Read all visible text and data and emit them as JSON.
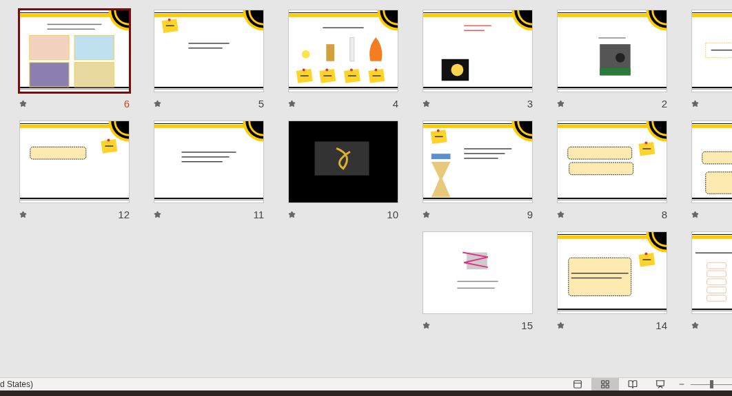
{
  "rows": [
    [
      {
        "number": "6",
        "selected": true,
        "kind": "gallery"
      },
      {
        "number": "5",
        "selected": false,
        "kind": "note"
      },
      {
        "number": "4",
        "selected": false,
        "kind": "objects"
      },
      {
        "number": "3",
        "selected": false,
        "kind": "bulb"
      },
      {
        "number": "2",
        "selected": false,
        "kind": "photo"
      },
      {
        "selected": false,
        "kind": "framed"
      }
    ],
    [
      {
        "number": "12",
        "selected": false,
        "kind": "notebox"
      },
      {
        "number": "11",
        "selected": false,
        "kind": "text"
      },
      {
        "number": "10",
        "selected": false,
        "kind": "calligraphy"
      },
      {
        "number": "9",
        "selected": false,
        "kind": "hourglass"
      },
      {
        "number": "8",
        "selected": false,
        "kind": "boxes"
      },
      {
        "selected": false,
        "kind": "widebox"
      }
    ],
    [
      {
        "number": "15",
        "selected": false,
        "kind": "logo"
      },
      {
        "number": "14",
        "selected": false,
        "kind": "bigbox"
      },
      {
        "selected": false,
        "kind": "table"
      }
    ]
  ],
  "status_bar": {
    "text": "d States)",
    "views": [
      {
        "kind": "normal",
        "selected": false
      },
      {
        "kind": "sorter",
        "selected": true
      },
      {
        "kind": "reading",
        "selected": false
      },
      {
        "kind": "show",
        "selected": false
      }
    ]
  }
}
